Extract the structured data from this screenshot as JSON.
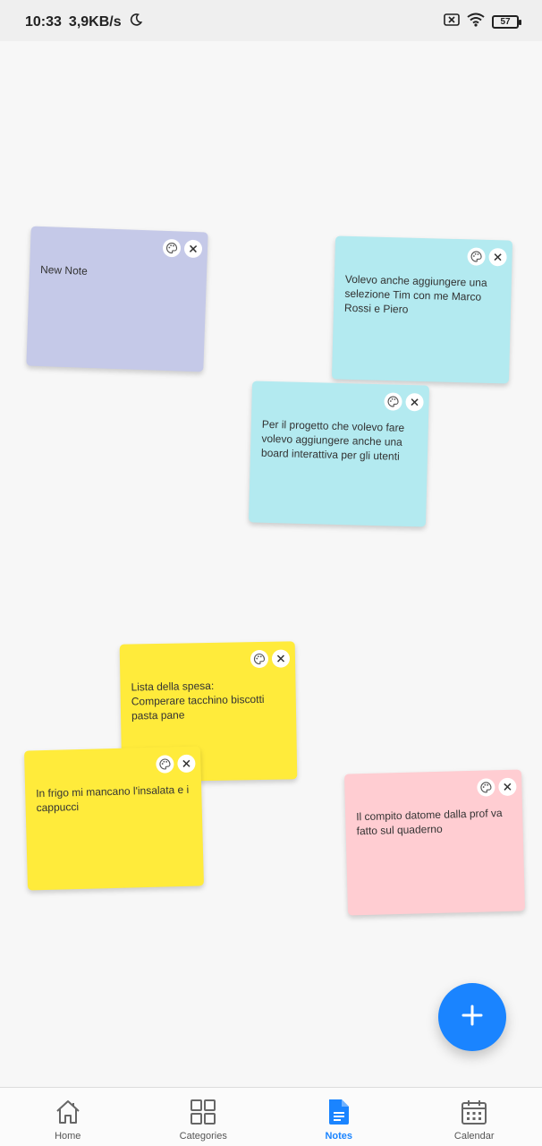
{
  "status_bar": {
    "time": "10:33",
    "speed": "3,9KB/s",
    "battery": "57"
  },
  "notes": [
    {
      "text": "New Note",
      "color": "#c5c9e8"
    },
    {
      "text": "Volevo anche aggiungere una selezione Tim con me Marco Rossi e Piero",
      "color": "#b3eaf0"
    },
    {
      "text": "Per il progetto che volevo fare volevo aggiungere anche una board interattiva per gli utenti",
      "color": "#b3eaf0"
    },
    {
      "text": "Lista della spesa:\nComperare tacchino biscotti pasta pane",
      "color": "#ffeb3b"
    },
    {
      "text": "In frigo mi mancano l'insalata e i cappucci",
      "color": "#ffeb3b"
    },
    {
      "text": "Il compito datome dalla prof va fatto sul quaderno",
      "color": "#ffcdd2"
    }
  ],
  "nav": {
    "home": "Home",
    "categories": "Categories",
    "notes": "Notes",
    "calendar": "Calendar"
  },
  "colors": {
    "accent": "#1a84ff",
    "background": "#f7f7f7"
  }
}
